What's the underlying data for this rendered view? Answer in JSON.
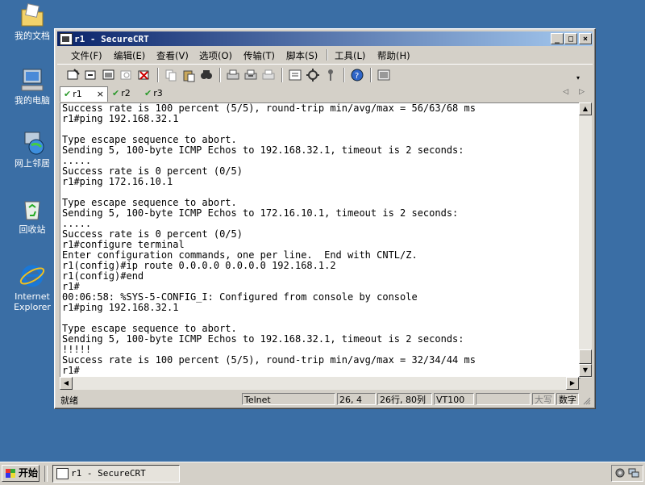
{
  "desktop": {
    "icons": [
      {
        "label": "我的文档"
      },
      {
        "label": "我的电脑"
      },
      {
        "label": "网上邻居"
      },
      {
        "label": "回收站"
      },
      {
        "label": "Internet Explorer"
      }
    ]
  },
  "window": {
    "title": "r1 - SecureCRT",
    "controls": {
      "minimize": "_",
      "maximize": "□",
      "close": "×"
    }
  },
  "menu": [
    "文件(F)",
    "编辑(E)",
    "查看(V)",
    "选项(O)",
    "传输(T)",
    "脚本(S)",
    "工具(L)",
    "帮助(H)"
  ],
  "tabs": [
    {
      "label": "r1",
      "close": "×"
    },
    {
      "label": "r2"
    },
    {
      "label": "r3"
    }
  ],
  "terminal": {
    "lines": [
      "Success rate is 100 percent (5/5), round-trip min/avg/max = 56/63/68 ms",
      "r1#ping 192.168.32.1",
      "",
      "Type escape sequence to abort.",
      "Sending 5, 100-byte ICMP Echos to 192.168.32.1, timeout is 2 seconds:",
      ".....",
      "Success rate is 0 percent (0/5)",
      "r1#ping 172.16.10.1",
      "",
      "Type escape sequence to abort.",
      "Sending 5, 100-byte ICMP Echos to 172.16.10.1, timeout is 2 seconds:",
      ".....",
      "Success rate is 0 percent (0/5)",
      "r1#configure terminal",
      "Enter configuration commands, one per line.  End with CNTL/Z.",
      "r1(config)#ip route 0.0.0.0 0.0.0.0 192.168.1.2",
      "r1(config)#end",
      "r1#",
      "00:06:58: %SYS-5-CONFIG_I: Configured from console by console",
      "r1#ping 192.168.32.1",
      "",
      "Type escape sequence to abort.",
      "Sending 5, 100-byte ICMP Echos to 192.168.32.1, timeout is 2 seconds:",
      "!!!!!",
      "Success rate is 100 percent (5/5), round-trip min/avg/max = 32/34/44 ms",
      "r1#"
    ]
  },
  "status": {
    "ready": "就绪",
    "protocol": "Telnet",
    "cursor": "26,  4",
    "size": "26行, 80列",
    "emulation": "VT100",
    "caps": "大写",
    "num": "数字"
  },
  "taskbar": {
    "start": "开始",
    "task": "r1 - SecureCRT"
  }
}
